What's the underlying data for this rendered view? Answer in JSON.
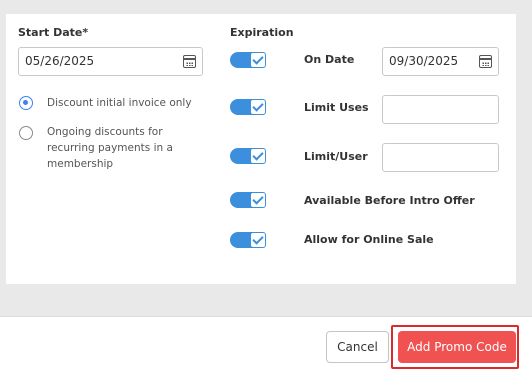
{
  "left": {
    "start_date_label": "Start Date*",
    "start_date_value": "05/26/2025",
    "discount_options": [
      {
        "label": "Discount initial invoice only",
        "selected": true
      },
      {
        "label_lines": [
          "Ongoing discounts for",
          "recurring payments in a",
          "membership"
        ],
        "selected": false
      }
    ]
  },
  "right": {
    "expiration_label": "Expiration",
    "rows": [
      {
        "label": "On Date",
        "enabled": true,
        "value": "09/30/2025"
      },
      {
        "label": "Limit Uses",
        "enabled": true,
        "value": ""
      },
      {
        "label": "Limit/User",
        "enabled": true,
        "value": ""
      },
      {
        "label": "Available Before Intro Offer",
        "enabled": true
      },
      {
        "label": "Allow for Online Sale",
        "enabled": true
      }
    ]
  },
  "footer": {
    "cancel_label": "Cancel",
    "add_label": "Add Promo Code"
  },
  "colors": {
    "accent": "#3b8fdc",
    "primary_button": "#f05252",
    "highlight": "#d92b2b"
  }
}
